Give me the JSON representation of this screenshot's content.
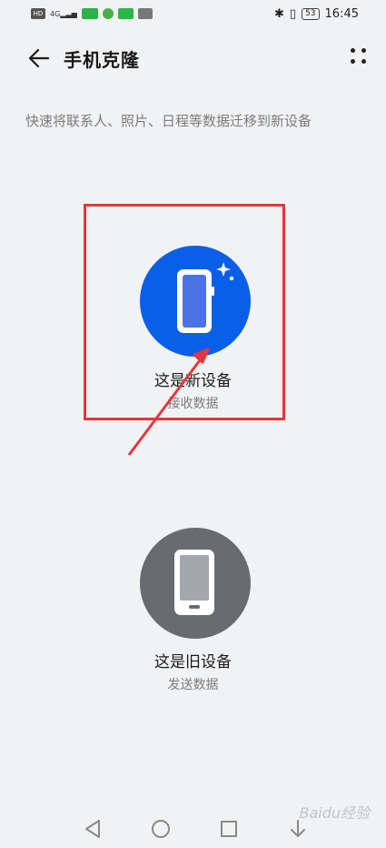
{
  "status_bar": {
    "left_icons": [
      "hd-icon",
      "signal-icon",
      "app-badge-1",
      "app-badge-2",
      "app-badge-3",
      "gallery-icon"
    ],
    "hd_label": "HD",
    "signal_label": "4G",
    "battery": "53",
    "time": "16:45"
  },
  "header": {
    "title": "手机克隆"
  },
  "subtitle": "快速将联系人、照片、日程等数据迁移到新设备",
  "options": [
    {
      "title": "这是新设备",
      "subtitle": "接收数据"
    },
    {
      "title": "这是旧设备",
      "subtitle": "发送数据"
    }
  ],
  "colors": {
    "new_device": "#0a5fe8",
    "old_device": "#686b70",
    "annotation": "#e2383d"
  },
  "watermark": "Baidu经验"
}
